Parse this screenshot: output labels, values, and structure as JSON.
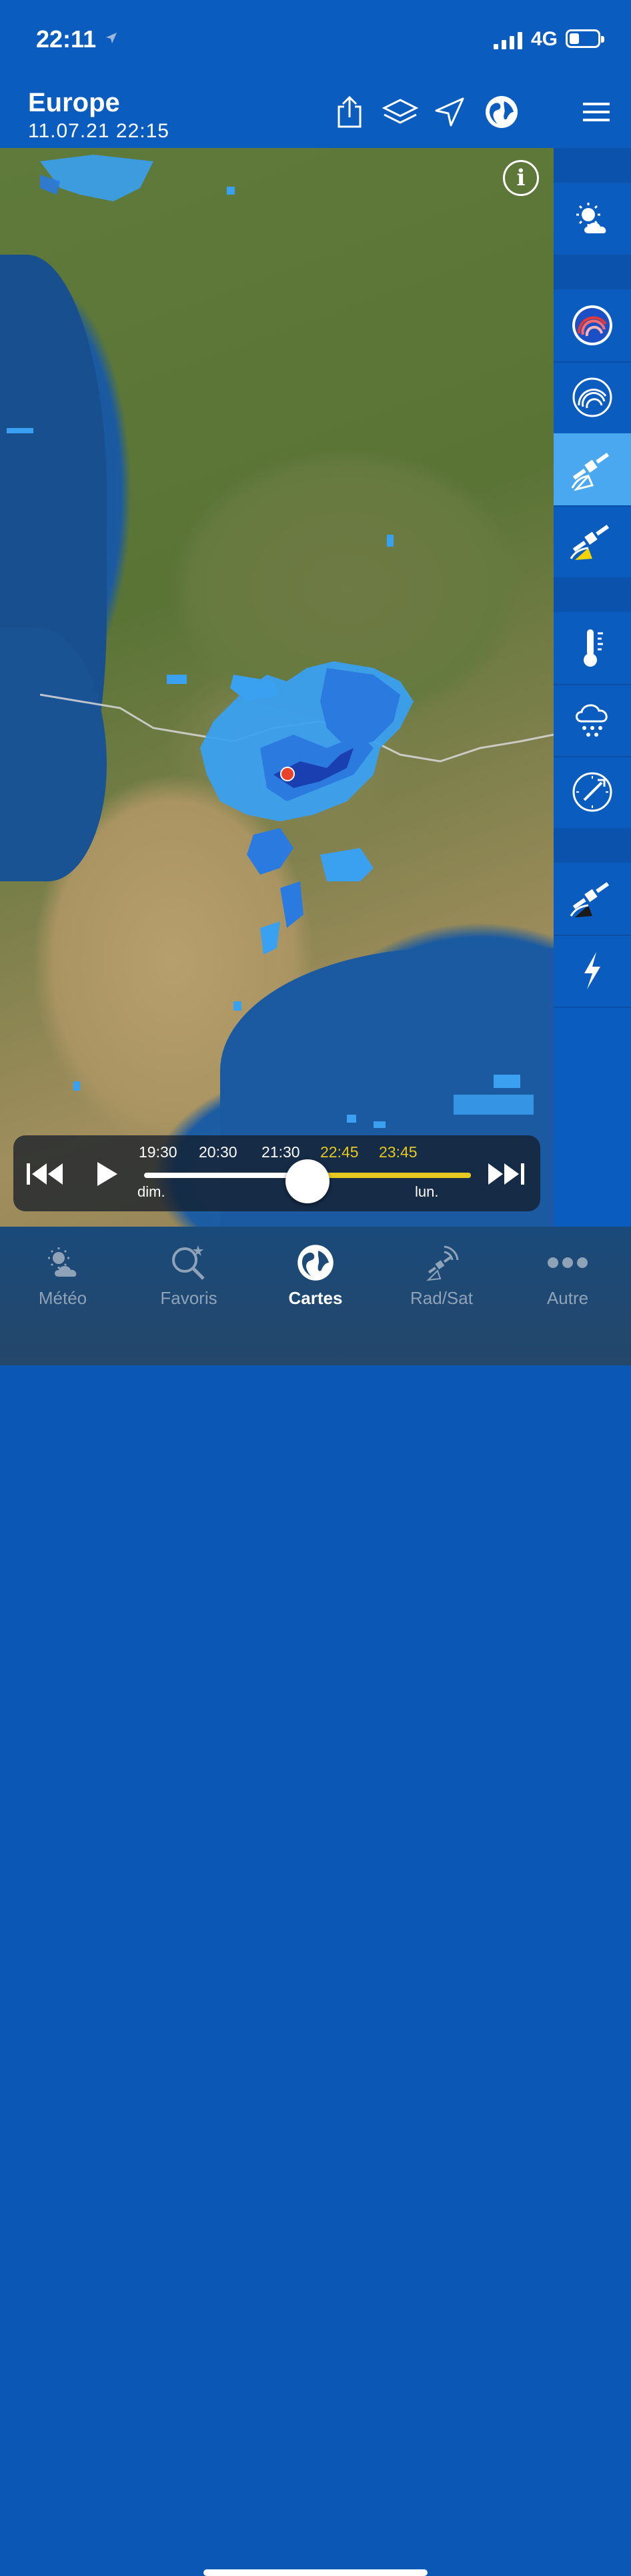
{
  "status": {
    "time": "22:11",
    "network": "4G",
    "battery_level": 0.35
  },
  "header": {
    "region": "Europe",
    "datetime": "11.07.21 22:15",
    "icons": [
      "share-icon",
      "layers-icon",
      "location-icon",
      "globe-icon",
      "menu-icon"
    ]
  },
  "map": {
    "info_icon": "i",
    "radar_colors": {
      "light": "#3aa0f0",
      "mid": "#2a7ae0",
      "dark": "#1a3fb0"
    },
    "marker_color": "#e8432a"
  },
  "sidebar": {
    "buttons": [
      "weather-sun-cloud-icon",
      "radar-color-icon",
      "radar-outline-icon",
      "satellite-active-icon",
      "satellite-yellow-icon",
      "thermometer-icon",
      "rain-cloud-icon",
      "wind-gauge-icon",
      "satellite-night-icon",
      "lightning-icon"
    ],
    "active_index": 3
  },
  "timeline": {
    "ticks": [
      "19:30",
      "20:30",
      "21:30",
      "22:45",
      "23:45"
    ],
    "day_start": "dim.",
    "day_end": "lun.",
    "progress": 0.5,
    "past_color": "#ffffff",
    "future_color": "#e7c821"
  },
  "tabs": [
    {
      "label": "Météo",
      "icon": "weather-icon"
    },
    {
      "label": "Favoris",
      "icon": "favorites-search-icon"
    },
    {
      "label": "Cartes",
      "icon": "globe-icon"
    },
    {
      "label": "Rad/Sat",
      "icon": "radar-satellite-icon"
    },
    {
      "label": "Autre",
      "icon": "more-icon"
    }
  ],
  "active_tab": "Cartes"
}
